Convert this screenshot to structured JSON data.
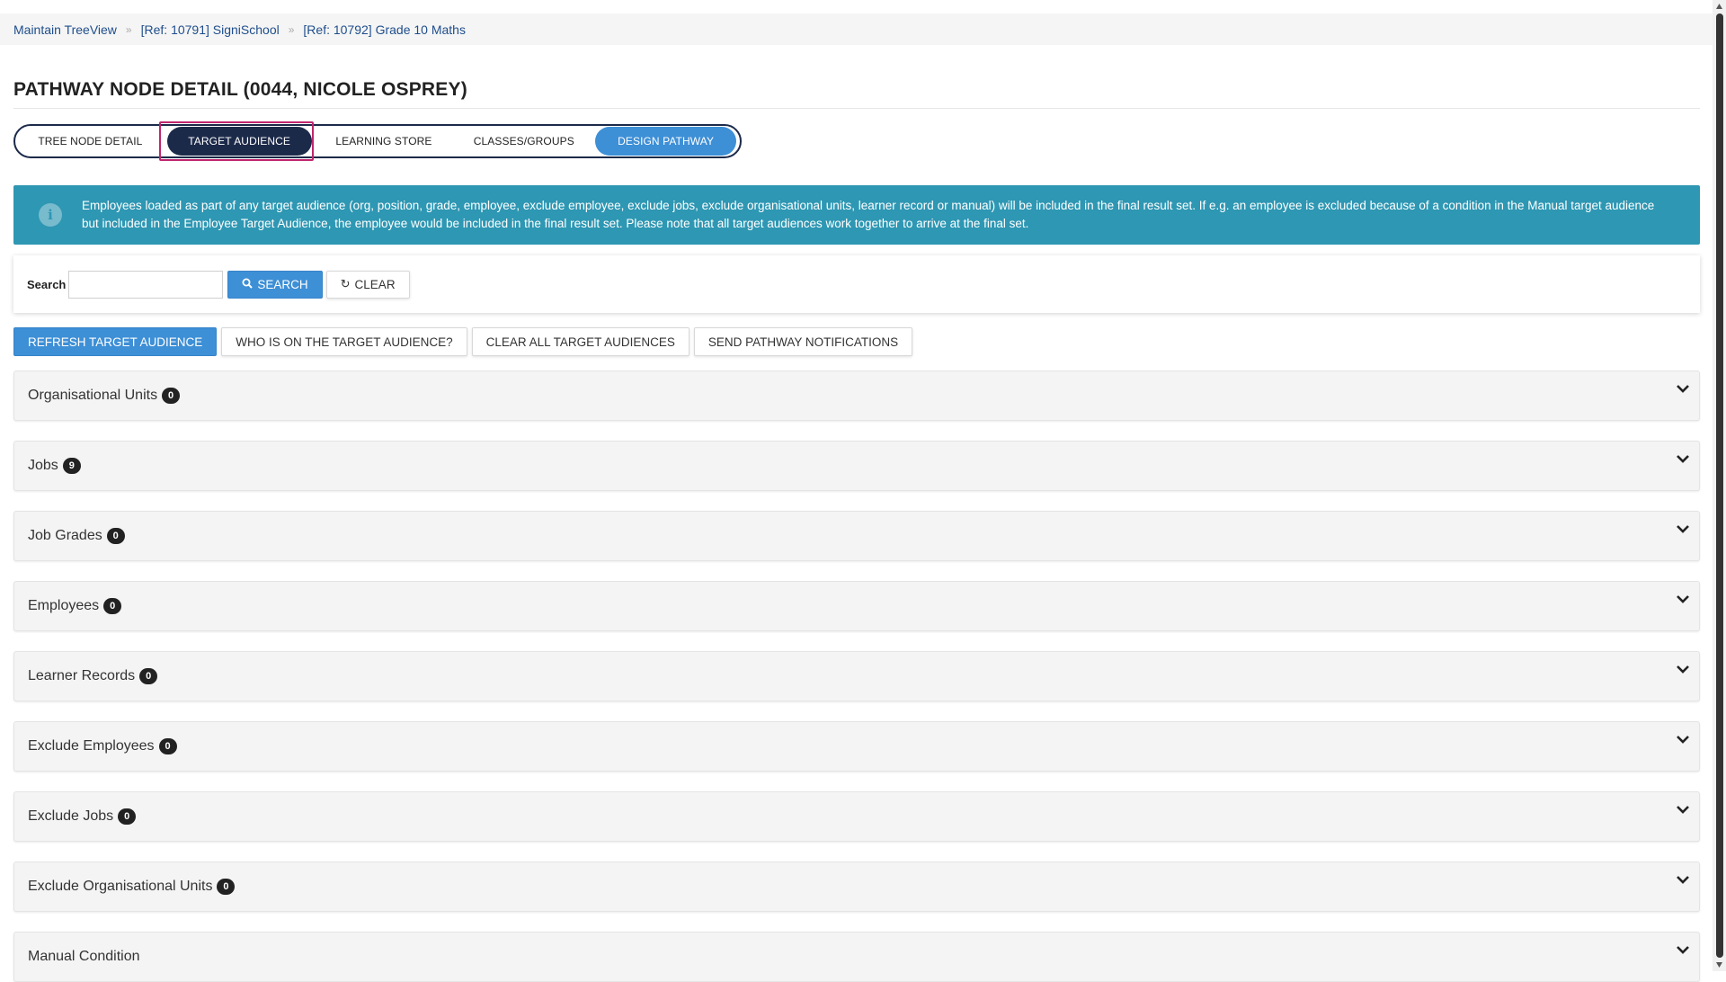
{
  "breadcrumb": {
    "items": [
      "Maintain TreeView",
      "[Ref: 10791] SigniSchool",
      "[Ref: 10792] Grade 10 Maths"
    ],
    "separator": "»"
  },
  "page_title": "PATHWAY NODE DETAIL (0044, NICOLE OSPREY)",
  "tabs": [
    {
      "label": "TREE NODE DETAIL",
      "state": "normal"
    },
    {
      "label": "TARGET AUDIENCE",
      "state": "active"
    },
    {
      "label": "LEARNING STORE",
      "state": "normal"
    },
    {
      "label": "CLASSES/GROUPS",
      "state": "normal"
    },
    {
      "label": "DESIGN PATHWAY",
      "state": "accent"
    }
  ],
  "info": {
    "icon": "info-icon",
    "text": "Employees loaded as part of any target audience (org, position, grade, employee, exclude employee, exclude jobs, exclude organisational units, learner record or manual) will be included in the final result set. If e.g. an employee is excluded because of a condition in the Manual target audience but included in the Employee Target Audience, the employee would be included in the final result set. Please note that all target audiences work together to arrive at the final set."
  },
  "search": {
    "label": "Search",
    "value": "",
    "placeholder": "",
    "search_button": "SEARCH",
    "clear_button": "CLEAR"
  },
  "actions": {
    "refresh": "REFRESH TARGET AUDIENCE",
    "who": "WHO IS ON THE TARGET AUDIENCE?",
    "clear_all": "CLEAR ALL TARGET AUDIENCES",
    "send": "SEND PATHWAY NOTIFICATIONS"
  },
  "sections": [
    {
      "title": "Organisational Units",
      "count": "0"
    },
    {
      "title": "Jobs",
      "count": "9"
    },
    {
      "title": "Job Grades",
      "count": "0"
    },
    {
      "title": "Employees",
      "count": "0"
    },
    {
      "title": "Learner Records",
      "count": "0"
    },
    {
      "title": "Exclude Employees",
      "count": "0"
    },
    {
      "title": "Exclude Jobs",
      "count": "0"
    },
    {
      "title": "Exclude Organisational Units",
      "count": "0"
    },
    {
      "title": "Manual Condition",
      "count": ""
    }
  ],
  "colors": {
    "primary": "#3d8fd6",
    "navy": "#1c2a4a",
    "info": "#2e97b3",
    "focus_ring": "#c0266e"
  }
}
